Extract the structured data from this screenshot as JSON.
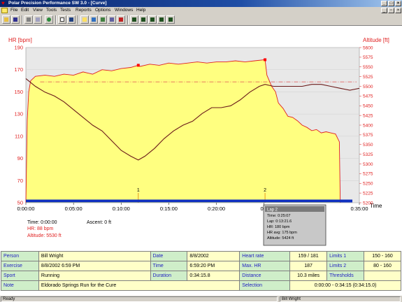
{
  "window": {
    "title": "Polar Precision Performance SW 3.0 - [Curve]"
  },
  "menu": [
    "File",
    "Edit",
    "View",
    "Tools",
    "Tests",
    "Reports",
    "Options",
    "Windows",
    "Help"
  ],
  "toolbar": {
    "buttons": [
      "open-icon",
      "save-icon",
      "print-icon",
      "preview-icon",
      "globe-icon",
      "calendar-icon",
      "exercise-icon",
      "curve-icon",
      "trend-icon",
      "bar-chart-icon",
      "weekly-report-icon",
      "monthly-report-icon",
      "yearly-report-icon",
      "diary-report-icon",
      "summary-report-icon"
    ]
  },
  "chart_data": {
    "type": "line",
    "left_axis_label": "HR [bpm]",
    "right_axis_label": "Altitude [ft]",
    "x_axis_label": "Time",
    "x_ticks": [
      "0:00:00",
      "0:05:00",
      "0:10:00",
      "0:15:00",
      "0:20:00",
      "0:2",
      "0:35:00"
    ],
    "y_left_ticks": [
      190,
      170,
      150,
      130,
      110,
      90,
      70,
      50
    ],
    "y_right_ticks": [
      5600,
      5575,
      5550,
      5525,
      5500,
      5475,
      5450,
      5425,
      5400,
      5375,
      5350,
      5325,
      5300,
      5275,
      5250,
      5225,
      5200
    ],
    "hr_range": [
      50,
      190
    ],
    "alt_range": [
      5200,
      5600
    ],
    "time_range_min": [
      0,
      35
    ],
    "series": [
      {
        "name": "HR",
        "color": "#e02020",
        "fill": "#ffff80",
        "points": [
          [
            0,
            50
          ],
          [
            0.15,
            125
          ],
          [
            0.3,
            150
          ],
          [
            0.5,
            160
          ],
          [
            1,
            164
          ],
          [
            2,
            165
          ],
          [
            3,
            164
          ],
          [
            4,
            166
          ],
          [
            5,
            165
          ],
          [
            6,
            168
          ],
          [
            7,
            166
          ],
          [
            8,
            170
          ],
          [
            9,
            169
          ],
          [
            10,
            171
          ],
          [
            11,
            172
          ],
          [
            11.8,
            174
          ],
          [
            12,
            173
          ],
          [
            13,
            175
          ],
          [
            14,
            174
          ],
          [
            15,
            176
          ],
          [
            16,
            175
          ],
          [
            17,
            176
          ],
          [
            18,
            177
          ],
          [
            19,
            176
          ],
          [
            20,
            177
          ],
          [
            21,
            177
          ],
          [
            22,
            178
          ],
          [
            23,
            177
          ],
          [
            24,
            178
          ],
          [
            25.1,
            179
          ],
          [
            25.3,
            165
          ],
          [
            25.8,
            155
          ],
          [
            26.2,
            150
          ],
          [
            26.5,
            140
          ],
          [
            27,
            135
          ],
          [
            27.5,
            128
          ],
          [
            28,
            127
          ],
          [
            28.5,
            124
          ],
          [
            29,
            120
          ],
          [
            29.5,
            118
          ],
          [
            30,
            115
          ],
          [
            30.5,
            116
          ],
          [
            31,
            113
          ],
          [
            31.5,
            114
          ],
          [
            32,
            113
          ],
          [
            32.5,
            112
          ],
          [
            32.9,
            105
          ],
          [
            33,
            50
          ]
        ]
      },
      {
        "name": "Altitude",
        "color": "#6b1a1a",
        "points": [
          [
            0,
            5520
          ],
          [
            1,
            5500
          ],
          [
            2,
            5485
          ],
          [
            3,
            5475
          ],
          [
            4,
            5460
          ],
          [
            5,
            5440
          ],
          [
            6,
            5420
          ],
          [
            7,
            5400
          ],
          [
            8,
            5385
          ],
          [
            9,
            5360
          ],
          [
            10,
            5335
          ],
          [
            11,
            5320
          ],
          [
            11.8,
            5310
          ],
          [
            12.5,
            5320
          ],
          [
            13.5,
            5340
          ],
          [
            14.5,
            5365
          ],
          [
            15.5,
            5385
          ],
          [
            16.5,
            5400
          ],
          [
            17.5,
            5410
          ],
          [
            18.5,
            5430
          ],
          [
            19.5,
            5445
          ],
          [
            20.5,
            5445
          ],
          [
            21.5,
            5450
          ],
          [
            22.5,
            5465
          ],
          [
            23.5,
            5485
          ],
          [
            24.5,
            5500
          ],
          [
            25.1,
            5505
          ],
          [
            26,
            5500
          ],
          [
            27,
            5500
          ],
          [
            28,
            5500
          ],
          [
            29,
            5500
          ],
          [
            30,
            5505
          ],
          [
            31,
            5505
          ],
          [
            32,
            5500
          ],
          [
            33,
            5495
          ],
          [
            34,
            5490
          ],
          [
            35,
            5495
          ]
        ]
      }
    ],
    "lap_markers": [
      {
        "label": "1",
        "time_min": 11.8
      },
      {
        "label": "2",
        "time_min": 25.1
      }
    ],
    "avg_hr": 159,
    "bottom_readout": {
      "time": "Time: 0:00:00",
      "hr": "HR: 88 bpm",
      "altitude": "Altitude: 5530 ft",
      "ascent": "Ascent: 0 ft"
    },
    "lap_tooltip": [
      "Lap 2",
      "Time: 0:25:07",
      "Lap: 0:13:21.6",
      "HR: 180 bpm",
      "HR avg: 175 bpm",
      "Altitude: 5424 ft"
    ]
  },
  "info": {
    "person_label": "Person",
    "person": "Bill Wright",
    "date_label": "Date",
    "date": "8/8/2002",
    "heart_rate_label": "Heart rate",
    "heart_rate": "159 / 181",
    "limits1_label": "Limits 1",
    "limits1": "150 - 160",
    "exercise_label": "Exercise",
    "exercise": "8/8/2002 6:59 PM",
    "time_label": "Time",
    "time": "6:59:20 PM",
    "max_hr_label": "Max. HR",
    "max_hr": "187",
    "limits2_label": "Limits 2",
    "limits2": "80 - 160",
    "sport_label": "Sport",
    "sport": "Running",
    "duration_label": "Duration",
    "duration": "0:34:15.8",
    "distance_label": "Distance",
    "distance": "10.3 miles",
    "thresholds_label": "Thresholds",
    "thresholds": "",
    "note_label": "Note",
    "note": "Eldorado Springs Run for the Cure",
    "selection_label": "Selection",
    "selection": "0:00:00 - 0:34:15 (0:34:15.0)"
  },
  "status": {
    "left": "Ready",
    "user": "Bill Wright"
  }
}
